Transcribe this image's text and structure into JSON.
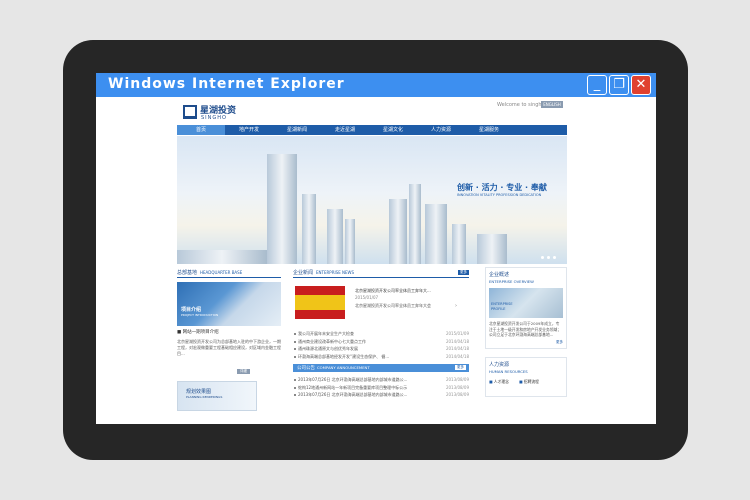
{
  "window": {
    "title": "Windows  Internet  Explorer",
    "min_icon": "_",
    "max_icon": "❐",
    "close_icon": "✕"
  },
  "site": {
    "logo_cn": "星湖投资",
    "logo_en": "SINGHO",
    "welcome": "Welcome to singho",
    "lang_button": "ENGLISH",
    "nav": [
      "首页",
      "地产开发",
      "星湖新闻",
      "走近星湖",
      "星湖文化",
      "人力资源",
      "星湖服务"
    ],
    "banner": {
      "slogan": "创新 · 活力 · 专业 · 奉献",
      "slogan_en": "INNOVATION  VITALITY  PROFESSION  DEDICATION"
    },
    "hq": {
      "title": "总部基地",
      "title_en": "HEADQUARTER BASE",
      "img_caption": "项目介绍",
      "img_caption_en": "PROJECT INTRODUCTION",
      "item_title": "■ 网站一期项目介绍",
      "text": "北京星湖投资开发公司为总部基地入驻的中下游企业，一期工程，对宏观做重要工程基础相应建设，对区域内金融工程目...",
      "more_btn": "详细"
    },
    "plan": {
      "caption": "规划效果图",
      "caption_en": "PLANNING RENDERINGS"
    },
    "news": {
      "title": "企业新闻",
      "title_en": "ENTERPRISE NEWS",
      "more": "更多",
      "top_title": "北京星湖投资开发公司率全体员工奔年大...",
      "top_date": "2015/01/07",
      "top_body": "北京星湖投资开发公司率全体员工奔年大会",
      "list": [
        {
          "text": "我公司开展年末安全生产大检查",
          "date": "2015/01/09"
        },
        {
          "text": "通州商业建设改革新中心七大重点工作",
          "date": "2014/04/18"
        },
        {
          "text": "通州珠源北通原文与创优秀年发展",
          "date": "2014/04/18"
        },
        {
          "text": "环渤海高端总部基地经发开发“建设生态保护、 循...",
          "date": "2014/04/18"
        }
      ]
    },
    "announce": {
      "title": "公司公告",
      "title_en": "COMPANY ANNOUNCEMENT",
      "more": "更多",
      "list": [
        {
          "text": "2013年07月26日 北京环渤海高端总部基地内部城市道路公...",
          "date": "2013/08/09"
        },
        {
          "text": "蛇构12地通州新网站一年新项目完备重要库项目整理中标公示",
          "date": "2013/08/09"
        },
        {
          "text": "2013年07月26日 北京环渤海高端总部基地内部城市道路公...",
          "date": "2013/08/09"
        }
      ]
    },
    "overview": {
      "title": "企业概述",
      "title_en": "ENTERPRISE OVERVIEW",
      "img_caption": "ENTERPRISE",
      "img_caption2": "PROFILE",
      "text": "北京星湖投资开发公司于2009年成立，专注于土地一级开发和房地产开发业务领域；公司立足于北京环渤海高端总部基地...",
      "more": "更多"
    },
    "hr": {
      "title": "人力资源",
      "title_en": "HUMAN RESOURCES",
      "link1": "人才理念",
      "link2": "招聘流程"
    }
  }
}
